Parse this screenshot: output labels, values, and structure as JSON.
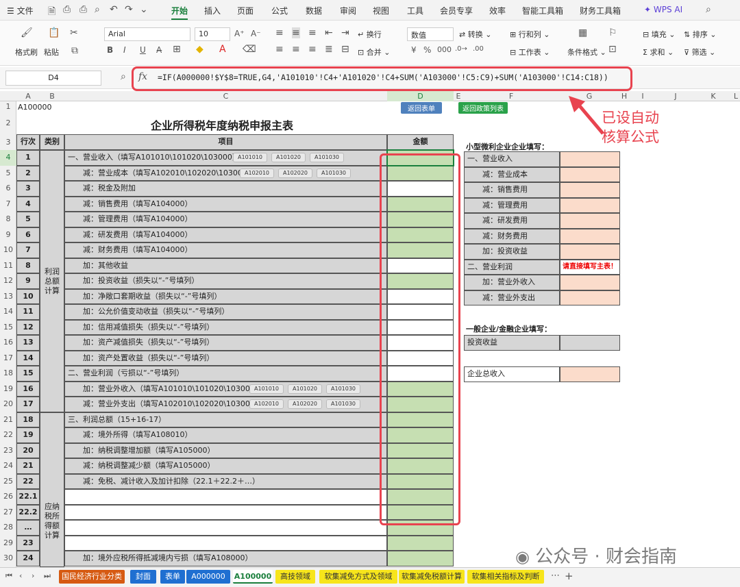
{
  "menubar": {
    "file": "文件",
    "items": [
      "开始",
      "插入",
      "页面",
      "公式",
      "数据",
      "审阅",
      "视图",
      "工具",
      "会员专享",
      "效率",
      "智能工具箱",
      "财务工具箱"
    ],
    "wps_ai": "WPS AI"
  },
  "ribbon": {
    "format_painter": "格式刷",
    "paste": "粘贴",
    "font": "Arial",
    "size": "10",
    "number_format": "数值",
    "wrap": "换行",
    "merge": "合并",
    "convert": "转换",
    "rowcol": "行和列",
    "worksheet": "工作表",
    "cond_format": "条件格式",
    "fill": "填充",
    "sort": "排序",
    "sum": "求和",
    "filter": "筛选"
  },
  "formula_bar": {
    "name_box": "D4",
    "fx": "fx",
    "formula": "=IF(A000000!$Y$8=TRUE,G4,'A101010'!C4+'A101020'!C4+SUM('A103000'!C5:C9)+SUM('A103000'!C14:C18))"
  },
  "columns": [
    "A",
    "B",
    "C",
    "D",
    "E",
    "F",
    "G",
    "H",
    "I",
    "J",
    "K",
    "L"
  ],
  "sheet": {
    "a1": "A100000",
    "title": "企业所得税年度纳税申报主表",
    "btn_back_table": "返回表单",
    "btn_back_policy": "返回政策列表",
    "annotation": "已设自动\n核算公式",
    "headers": {
      "rownum": "行次",
      "category": "类别",
      "item": "项目",
      "amount": "金额"
    },
    "category_profit": "利润\n总额\n计算",
    "category_taxable": "应纳\n税所\n得额\n计算",
    "rows": [
      {
        "r": "4",
        "n": "1",
        "text": "一、营业收入（填写A101010\\101020\\103000）",
        "btns": [
          "A101010",
          "A101020",
          "A101030"
        ],
        "d": "grn"
      },
      {
        "r": "5",
        "n": "2",
        "text": "　　减：营业成本（填写A102010\\102020\\103000",
        "btns": [
          "A102010",
          "A102020",
          "A101030"
        ],
        "d": "grn"
      },
      {
        "r": "6",
        "n": "3",
        "text": "　　减：税金及附加",
        "d": "w"
      },
      {
        "r": "7",
        "n": "4",
        "text": "　　减：销售费用（填写A104000）",
        "d": "grn"
      },
      {
        "r": "8",
        "n": "5",
        "text": "　　减：管理费用（填写A104000）",
        "d": "grn"
      },
      {
        "r": "9",
        "n": "6",
        "text": "　　减：研发费用（填写A104000）",
        "d": "grn"
      },
      {
        "r": "10",
        "n": "7",
        "text": "　　减：财务费用（填写A104000）",
        "d": "grn"
      },
      {
        "r": "11",
        "n": "8",
        "text": "　　加：其他收益",
        "d": "w"
      },
      {
        "r": "12",
        "n": "9",
        "text": "　　加：投资收益（损失以“-”号填列）",
        "d": "grn"
      },
      {
        "r": "13",
        "n": "10",
        "text": "　　加：净敞口套期收益（损失以“-”号填列）",
        "d": "w"
      },
      {
        "r": "14",
        "n": "11",
        "text": "　　加：公允价值变动收益（损失以“-”号填列）",
        "d": "w"
      },
      {
        "r": "15",
        "n": "12",
        "text": "　　加：信用减值损失（损失以“-”号填列）",
        "d": "w"
      },
      {
        "r": "16",
        "n": "13",
        "text": "　　加：资产减值损失（损失以“-”号填列）",
        "d": "w"
      },
      {
        "r": "17",
        "n": "14",
        "text": "　　加：资产处置收益（损失以“-”号填列）",
        "d": "w"
      },
      {
        "r": "18",
        "n": "15",
        "text": "二、营业利润（亏损以“-”号填列）",
        "d": "w"
      },
      {
        "r": "19",
        "n": "16",
        "text": "　　加：营业外收入（填写A101010\\101020\\103000",
        "btns": [
          "A101010",
          "A101020",
          "A101030"
        ],
        "d": "grn"
      },
      {
        "r": "20",
        "n": "17",
        "text": "　　减：营业外支出（填写A102010\\102020\\103000",
        "btns": [
          "A102010",
          "A102020",
          "A101030"
        ],
        "d": "grn"
      },
      {
        "r": "21",
        "n": "18",
        "text": "三、利润总额（15+16-17）",
        "d": "grn"
      },
      {
        "r": "22",
        "n": "19",
        "text": "　　减：境外所得（填写A108010）",
        "d": "grn"
      },
      {
        "r": "23",
        "n": "20",
        "text": "　　加：纳税调整增加额（填写A105000）",
        "d": "grn"
      },
      {
        "r": "24",
        "n": "21",
        "text": "　　减：纳税调整减少额（填写A105000）",
        "d": "grn"
      },
      {
        "r": "25",
        "n": "22",
        "text": "　　减：免税、减计收入及加计扣除（22.1＋22.2＋…）",
        "d": "grn"
      },
      {
        "r": "26",
        "n": "22.1",
        "text": "",
        "d": "grn"
      },
      {
        "r": "27",
        "n": "22.2",
        "text": "",
        "d": "grn"
      },
      {
        "r": "28",
        "n": "…",
        "text": "",
        "d": "grn"
      },
      {
        "r": "29",
        "n": "23",
        "text": "",
        "d": "grn"
      },
      {
        "r": "30",
        "n": "24",
        "text": "　　加：境外应税所得抵减境内亏损（填写A108000）",
        "d": "grn"
      }
    ],
    "small_title": "小型微利企业企业填写：",
    "small_rows": [
      "一、营业收入",
      "　　减：营业成本",
      "　　减：销售费用",
      "　　减：管理费用",
      "　　减：研发费用",
      "　　减：财务费用",
      "　　加：投资收益",
      "二、营业利润",
      "　　加：营业外收入",
      "　　减：营业外支出"
    ],
    "small_note": "请直接填写主表！",
    "general_title": "一般企业/金融企业填写：",
    "general_invest": "投资收益",
    "general_total": "企业总收入"
  },
  "tabs": [
    "国民经济行业分类",
    "封面",
    "表单",
    "A000000",
    "A100000",
    "高技领域",
    "软集减免方式及领域",
    "软集减免税额计算",
    "软集相关指标及判断"
  ],
  "watermark": "公众号 · 财会指南"
}
